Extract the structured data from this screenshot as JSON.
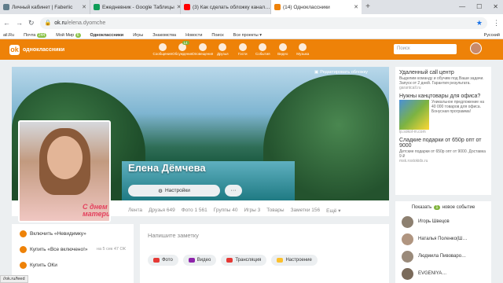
{
  "browser": {
    "tabs": [
      {
        "title": "Личный кабинет | Faberlic",
        "color": "#607d8b"
      },
      {
        "title": "Ежедневник - Google Таблицы",
        "color": "#0f9d58"
      },
      {
        "title": "(3) Как сделать обложку канал…",
        "color": "#ff0000"
      },
      {
        "title": "(14) Одноклассники",
        "color": "#ee8208"
      }
    ],
    "url_host": "ok.ru",
    "url_path": "/elena.dyomche",
    "bookmarks": [
      "ail.Ru",
      "Почта",
      "Мой Мир",
      "Одноклассники",
      "Игры",
      "Знакомства",
      "Новости",
      "Поиск",
      "Все проекты ▾"
    ],
    "mail_badge": "244",
    "world_badge": "6",
    "lang": "Русский"
  },
  "ok": {
    "logo": "одноклассники",
    "nav": [
      {
        "label": "Сообщения",
        "badge": ""
      },
      {
        "label": "Обсуждения",
        "badge": "14"
      },
      {
        "label": "Оповещения",
        "badge": ""
      },
      {
        "label": "Друзья",
        "badge": ""
      },
      {
        "label": "Гости",
        "badge": ""
      },
      {
        "label": "События",
        "badge": ""
      },
      {
        "label": "Видео",
        "badge": ""
      },
      {
        "label": "Музыка",
        "badge": ""
      }
    ],
    "search_placeholder": "Поиск"
  },
  "profile": {
    "edit_cover": "Редактировать обложку",
    "name": "Елена Дёмчева",
    "settings": "Настройки",
    "more": "···",
    "avatar_caption": "С днем матери!",
    "tabs": [
      "Лента",
      "Друзья 649",
      "Фото 1 561",
      "Группы 40",
      "Игры 3",
      "Товары",
      "Заметки 156",
      "Ещё ▾"
    ]
  },
  "left": {
    "items": [
      {
        "label": "Включить «Невидимку»",
        "price": ""
      },
      {
        "label": "Купить «Все включено!»",
        "price": "на 5 сек 47 ОК"
      },
      {
        "label": "Купить ОКи",
        "price": ""
      }
    ]
  },
  "note": {
    "placeholder": "Напишите заметку",
    "buttons": [
      {
        "label": "Фото",
        "color": "#e53935"
      },
      {
        "label": "Видео",
        "color": "#8e24aa"
      },
      {
        "label": "Трансляция",
        "color": "#e53935"
      },
      {
        "label": "Настроение",
        "color": "#fbc02d"
      }
    ]
  },
  "ads": [
    {
      "title": "Удаленный call центр",
      "text": "Выделим команду и обучим под Ваши задачи. Запуск от 2 дней. Гарантия результата.",
      "url": "garantcall.ru"
    },
    {
      "title": "Нужны канцтовары для офиса?",
      "text": "Уникальное предложение на 40 000 товаров для офиса. Бонусная программа!",
      "url": "lp.sokol-m.com"
    },
    {
      "title": "Сладкие подарки от 650р опт от 9000",
      "text": "Детские подарки от 650р опт от 9000. Доставка 9 ₽",
      "url": "msk.rostokids.ru"
    }
  ],
  "events": {
    "label_before": "Показать",
    "count": "1",
    "label_after": "новое событие",
    "friends": [
      "Игорь Швецов",
      "Наталья Пoленко(Ш…",
      "Людмила Пивоваро…",
      "EVGENIYA…"
    ]
  },
  "status_url": "//ok.ru/feed"
}
